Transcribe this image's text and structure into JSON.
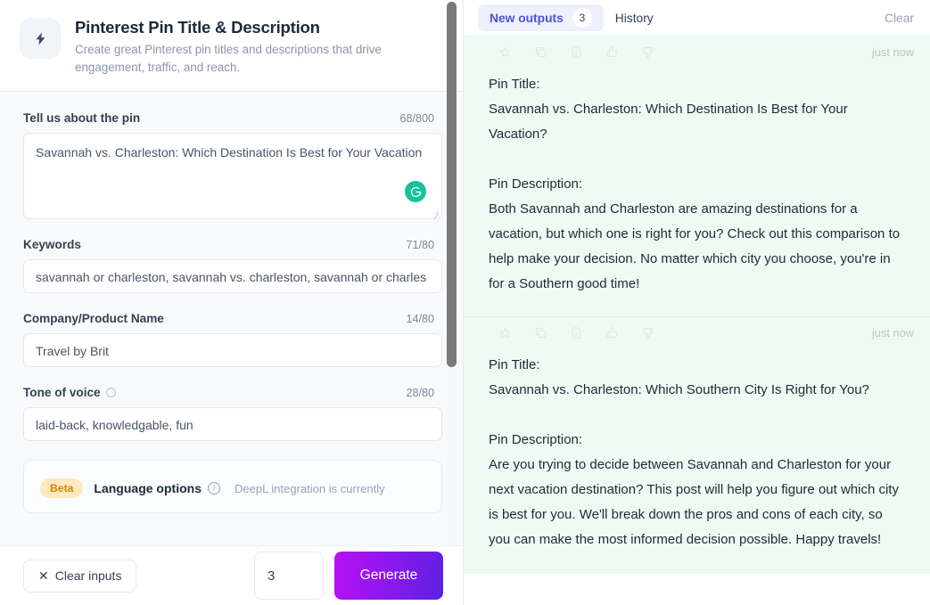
{
  "tool": {
    "icon": "lightning-bolt-icon",
    "title": "Pinterest Pin Title & Description",
    "subtitle": "Create great Pinterest pin titles and descriptions that drive engagement, traffic, and reach."
  },
  "form": {
    "fields": [
      {
        "label": "Tell us about the pin",
        "counter": "68/800",
        "value": "Savannah vs. Charleston: Which Destination Is Best for Your Vacation",
        "type": "textarea",
        "assistant_icon": "grammarly-icon"
      },
      {
        "label": "Keywords",
        "counter": "71/80",
        "value": "savannah or charleston, savannah vs. charleston, savannah or charles",
        "type": "input"
      },
      {
        "label": "Company/Product Name",
        "counter": "14/80",
        "value": "Travel by Brit",
        "type": "input"
      },
      {
        "label": "Tone of voice",
        "counter": "28/80",
        "value": "laid-back, knowledgable, fun",
        "type": "input",
        "has_info": true
      }
    ],
    "language_card": {
      "badge": "Beta",
      "label": "Language options",
      "note": "DeepL integration is currently"
    }
  },
  "actions": {
    "clear_label": "Clear inputs",
    "clear_icon": "close-x-icon",
    "count_value": "3",
    "generate_label": "Generate"
  },
  "results": {
    "tabs": [
      {
        "label": "New outputs",
        "count": "3",
        "active": true
      },
      {
        "label": "History",
        "count": "",
        "active": false
      }
    ],
    "clear_label": "Clear",
    "tool_icons": [
      "star-icon",
      "copy-icon",
      "document-icon",
      "thumbs-up-icon",
      "thumbs-down-icon"
    ],
    "cards": [
      {
        "timestamp": "just now",
        "title_label": "Pin Title:",
        "title_text": "Savannah vs. Charleston: Which Destination Is Best for Your Vacation?",
        "desc_label": "Pin Description:",
        "desc_text": "Both Savannah and Charleston are amazing destinations for a vacation, but which one is right for you? Check out this comparison to help make your decision. No matter which city you choose, you're in for a Southern good time!"
      },
      {
        "timestamp": "just now",
        "title_label": "Pin Title:",
        "title_text": "Savannah vs. Charleston: Which Southern City Is Right for You?",
        "desc_label": "Pin Description:",
        "desc_text": "Are you trying to decide between Savannah and Charleston for your next vacation destination? This post will help you figure out which city is best for you. We'll break down the pros and cons of each city, so you can make the most informed decision possible. Happy travels!"
      }
    ]
  },
  "colors": {
    "accent_tab": "#4e52d8",
    "generate_gradient_start": "#b810f0",
    "generate_gradient_end": "#5b21e0",
    "output_bg": "#effbf2",
    "beta_badge_bg": "#ffe8bc",
    "beta_badge_text": "#d08700",
    "grammarly_green": "#15c39a"
  }
}
